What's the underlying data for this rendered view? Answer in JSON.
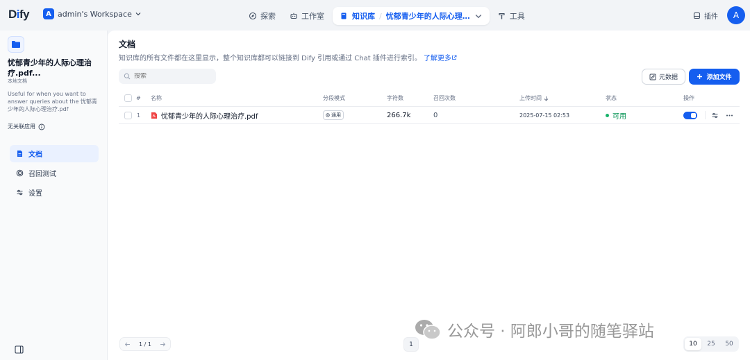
{
  "app": {
    "logo": "Dify"
  },
  "workspace": {
    "avatar_letter": "A",
    "name": "admin's Workspace"
  },
  "nav": {
    "explore": "探索",
    "studio": "工作室",
    "knowledge": "知识库",
    "current_dataset": "忧郁青少年的人际心理…",
    "tools": "工具"
  },
  "header_right": {
    "plugins": "插件",
    "user_avatar": "A"
  },
  "sidebar": {
    "kb_name": "忧郁青少年的人际心理治疗.pdf...",
    "kb_type": "本地文档",
    "kb_description": "Useful for when you want to answer queries about the 忧郁青少年的人际心理治疗.pdf",
    "related_apps": "无关联应用",
    "items": [
      {
        "label": "文档",
        "active": true
      },
      {
        "label": "召回测试",
        "active": false
      },
      {
        "label": "设置",
        "active": false
      }
    ]
  },
  "main": {
    "title": "文档",
    "subtitle": "知识库的所有文件都在这里显示，整个知识库都可以链接到 Dify 引用或通过 Chat 插件进行索引。",
    "learn_more": "了解更多",
    "search_placeholder": "搜索",
    "metadata_button": "元数据",
    "add_file_button": "添加文件"
  },
  "table": {
    "headers": {
      "num": "#",
      "name": "名称",
      "segment_mode": "分段模式",
      "chars": "字符数",
      "recall_count": "召回次数",
      "upload_time": "上传时间",
      "status": "状态",
      "actions": "操作"
    },
    "rows": [
      {
        "num": "1",
        "name": "忧郁青少年的人际心理治疗.pdf",
        "segment_mode": "通用",
        "chars": "266.7k",
        "recall_count": "0",
        "upload_time": "2025-07-15 02:53",
        "status": "可用",
        "enabled": true
      }
    ]
  },
  "pagination": {
    "page_indicator": "1 / 1",
    "current_page": "1",
    "page_sizes": [
      "10",
      "25",
      "50"
    ],
    "selected_size": "10"
  },
  "watermark": {
    "text": "公众号 · 阿郎小哥的随笔驿站"
  },
  "colors": {
    "primary": "#155eef",
    "success": "#17b26a",
    "background": "#f2f4f7"
  }
}
